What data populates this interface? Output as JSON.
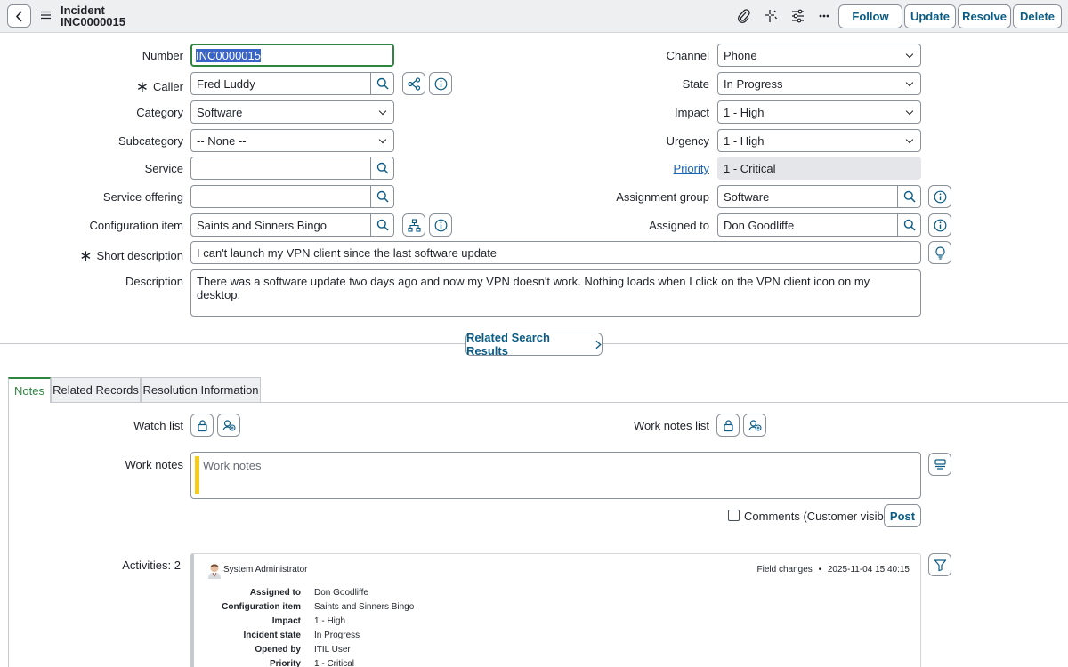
{
  "header": {
    "record_type": "Incident",
    "record_number": "INC0000015",
    "buttons": {
      "follow": "Follow",
      "update": "Update",
      "resolve": "Resolve",
      "delete": "Delete"
    }
  },
  "form": {
    "number": {
      "label": "Number",
      "value": "INC0000015"
    },
    "caller": {
      "label": "Caller",
      "value": "Fred Luddy"
    },
    "category": {
      "label": "Category",
      "value": "Software"
    },
    "subcategory": {
      "label": "Subcategory",
      "value": "-- None --"
    },
    "service": {
      "label": "Service",
      "value": ""
    },
    "service_offering": {
      "label": "Service offering",
      "value": ""
    },
    "configuration_item": {
      "label": "Configuration item",
      "value": "Saints and Sinners Bingo"
    },
    "short_description": {
      "label": "Short description",
      "value": "I can't launch my VPN client since the last software update"
    },
    "description": {
      "label": "Description",
      "value": "There was a software update two days ago and now my VPN doesn't work. Nothing loads when I click on the VPN client icon on my desktop."
    },
    "channel": {
      "label": "Channel",
      "value": "Phone"
    },
    "state": {
      "label": "State",
      "value": "In Progress"
    },
    "impact": {
      "label": "Impact",
      "value": "1 - High"
    },
    "urgency": {
      "label": "Urgency",
      "value": "1 - High"
    },
    "priority": {
      "label": "Priority",
      "value": "1 - Critical"
    },
    "assignment_group": {
      "label": "Assignment group",
      "value": "Software"
    },
    "assigned_to": {
      "label": "Assigned to",
      "value": "Don Goodliffe"
    }
  },
  "related_search_label": "Related Search Results",
  "tabs": [
    {
      "label": "Notes"
    },
    {
      "label": "Related Records"
    },
    {
      "label": "Resolution Information"
    }
  ],
  "notes": {
    "watch_list_label": "Watch list",
    "work_notes_list_label": "Work notes list",
    "work_notes_label": "Work notes",
    "work_notes_placeholder": "Work notes",
    "comments_label": "Comments (Customer visible)",
    "post_label": "Post",
    "activities_label": "Activities: 2"
  },
  "activity": {
    "user": "System Administrator",
    "type": "Field changes",
    "separator": "•",
    "timestamp": "2025-11-04 15:40:15",
    "changes": [
      {
        "label": "Assigned to",
        "value": "Don Goodliffe"
      },
      {
        "label": "Configuration item",
        "value": "Saints and Sinners Bingo"
      },
      {
        "label": "Impact",
        "value": "1 - High"
      },
      {
        "label": "Incident state",
        "value": "In Progress"
      },
      {
        "label": "Opened by",
        "value": "ITIL User"
      },
      {
        "label": "Priority",
        "value": "1 - Critical"
      }
    ]
  },
  "colors": {
    "accent_green": "#2e8540",
    "button_text": "#0a5c85",
    "link": "#1a63b8",
    "work_notes_bar": "#f5cc1a",
    "selection": "#3a65c8"
  }
}
